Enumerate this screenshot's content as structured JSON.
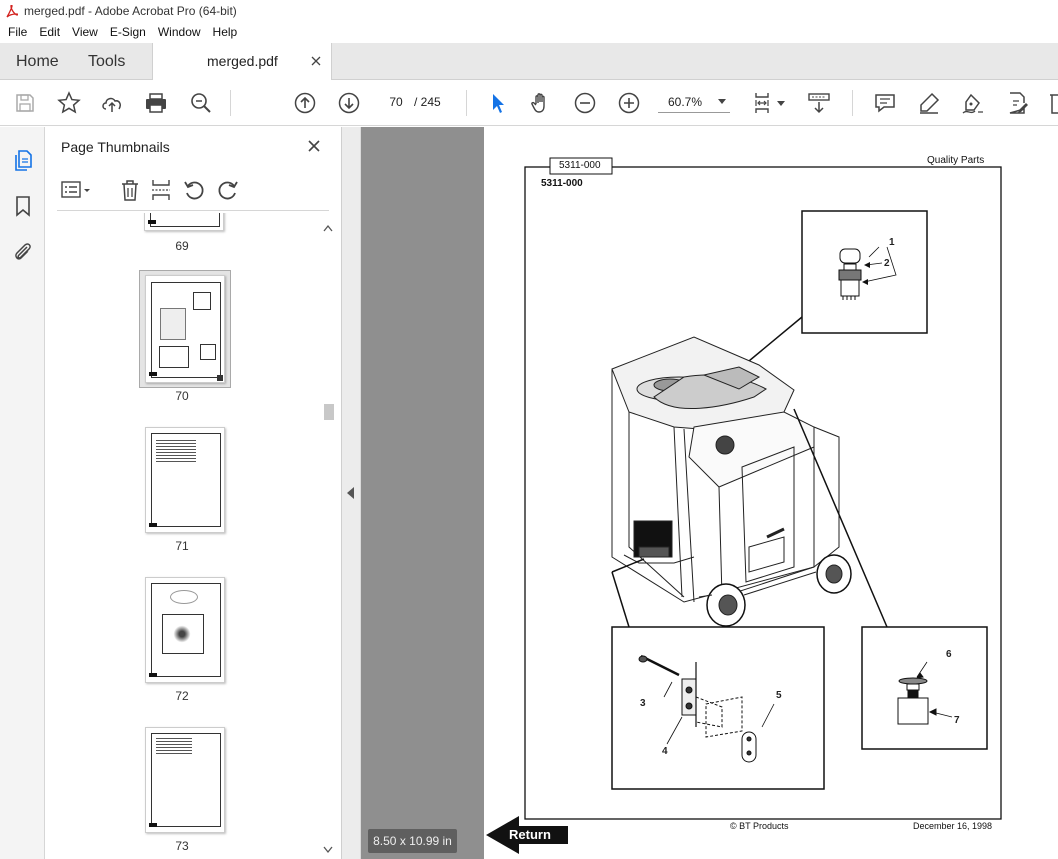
{
  "window": {
    "title": "merged.pdf - Adobe Acrobat Pro (64-bit)"
  },
  "menu": {
    "items": [
      "File",
      "Edit",
      "View",
      "E-Sign",
      "Window",
      "Help"
    ]
  },
  "tabs": {
    "home": "Home",
    "tools": "Tools",
    "document": "merged.pdf"
  },
  "toolbar": {
    "current_page": "70",
    "page_total": "/  245",
    "zoom": "60.7%"
  },
  "sidebar": {
    "panel_title": "Page Thumbnails",
    "thumbnails": [
      {
        "page": "69"
      },
      {
        "page": "70"
      },
      {
        "page": "71"
      },
      {
        "page": "72"
      },
      {
        "page": "73"
      }
    ]
  },
  "document_page": {
    "tab_label": "5311-000",
    "part_number": "5311-000",
    "header_right": "Quality Parts",
    "callouts": [
      "1",
      "2",
      "3",
      "4",
      "5",
      "6",
      "7"
    ],
    "footer_center": "© BT Products",
    "footer_right": "December 16, 1998",
    "return_button": "Return"
  },
  "status": {
    "page_size": "8.50 x 10.99 in"
  },
  "colors": {
    "accent_blue": "#1473e6",
    "acrobat_red": "#d3231f",
    "viewer_gray": "#8f8f8f"
  }
}
